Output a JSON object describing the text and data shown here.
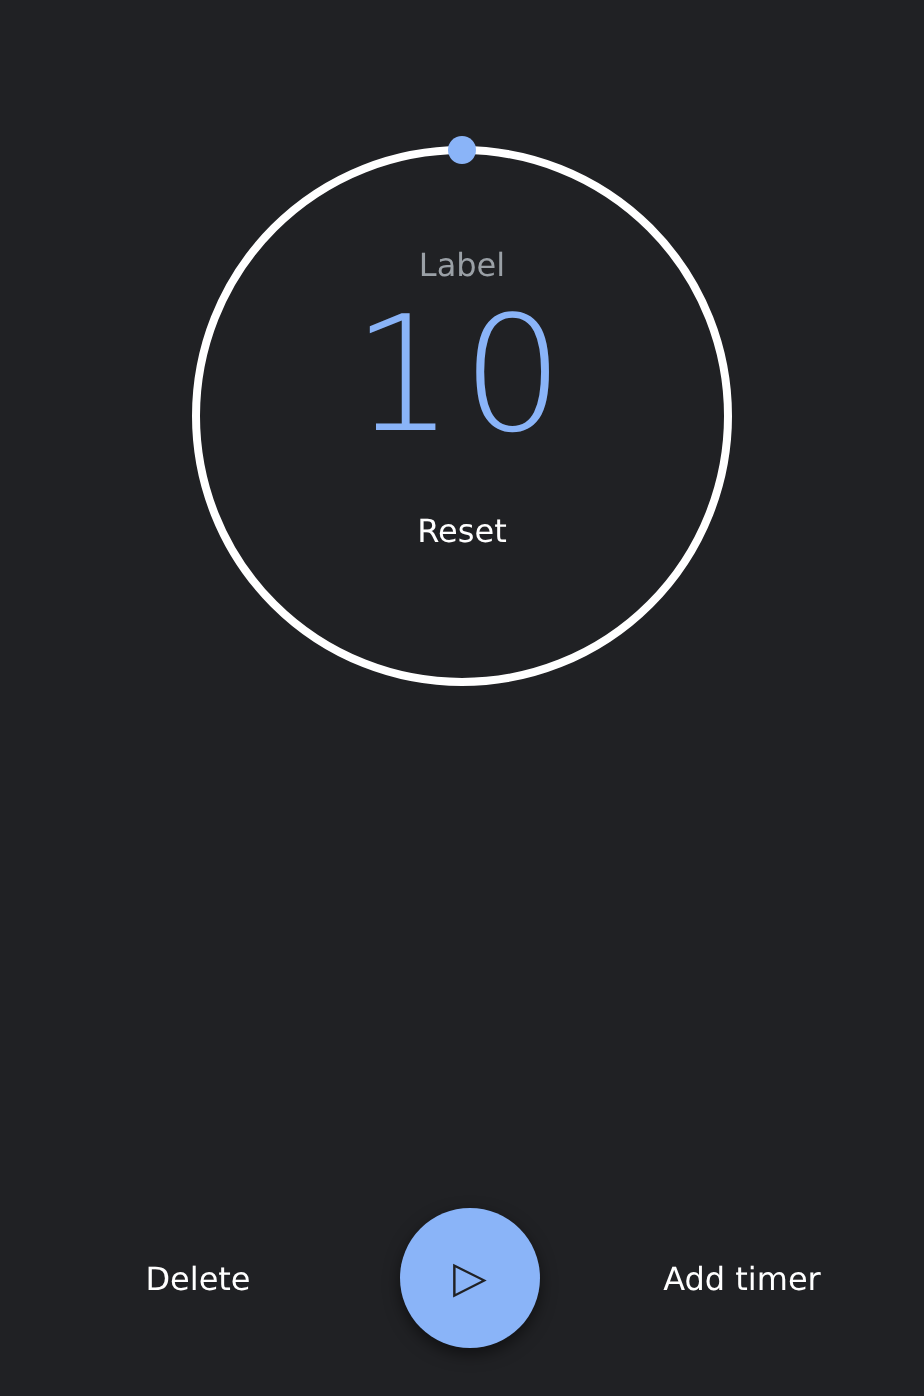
{
  "timer": {
    "label": "Label",
    "time": "10",
    "reset": "Reset",
    "level": 1
  },
  "actions": {
    "delete": "Delete",
    "play": "▷",
    "add": "Add timer"
  }
}
